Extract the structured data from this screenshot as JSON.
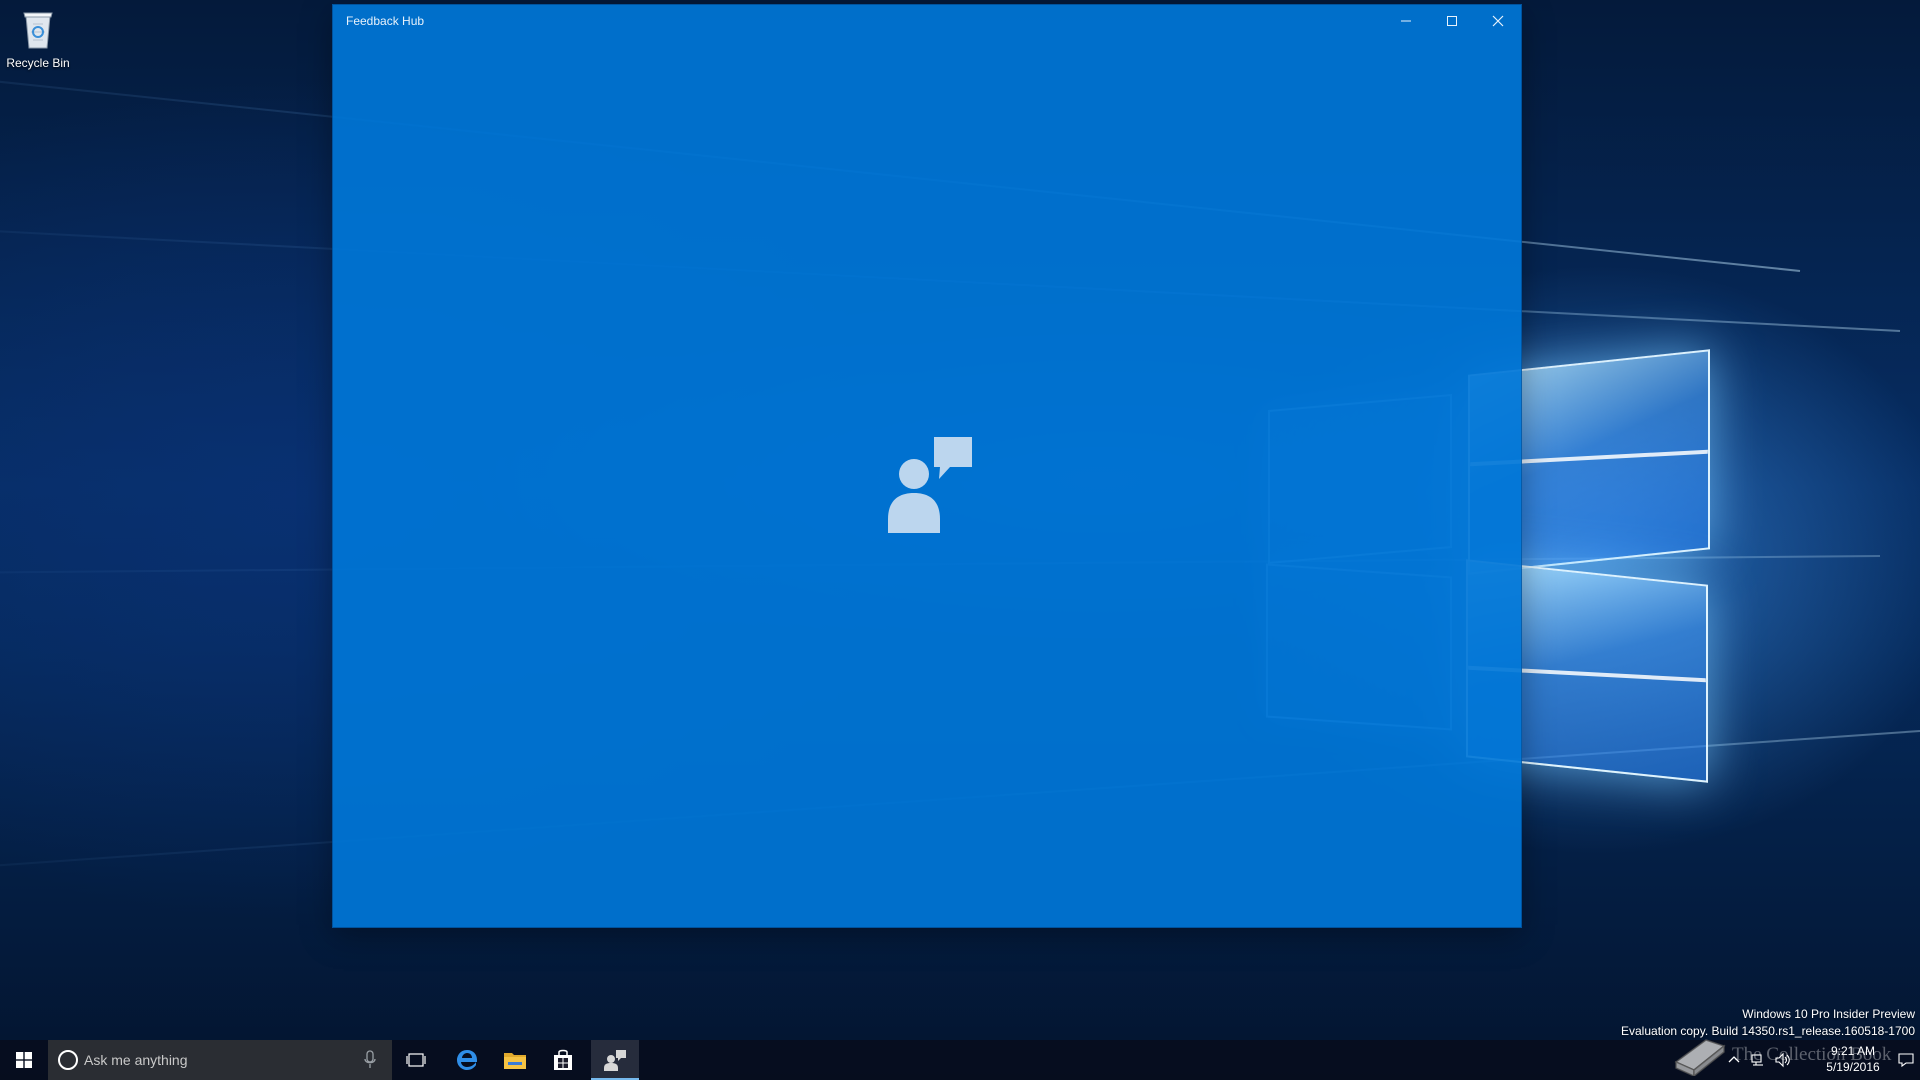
{
  "desktop": {
    "icons": [
      {
        "label": "Recycle Bin",
        "icon": "recycle-bin-icon"
      }
    ]
  },
  "window": {
    "title": "Feedback Hub",
    "controls": {
      "minimize": "minimize-icon",
      "maximize": "maximize-icon",
      "close": "close-icon"
    },
    "splash_icon": "feedback-hub-icon",
    "background_color": "#0078d7"
  },
  "taskbar": {
    "start_icon": "windows-logo-icon",
    "search": {
      "placeholder": "Ask me anything",
      "icon": "cortana-circle-icon",
      "mic_icon": "microphone-icon"
    },
    "pinned": [
      {
        "name": "task-view",
        "icon": "task-view-icon"
      },
      {
        "name": "edge",
        "icon": "edge-icon",
        "color": "#1e88e5"
      },
      {
        "name": "file-explorer",
        "icon": "folder-icon",
        "color": "#f6c343"
      },
      {
        "name": "store",
        "icon": "store-icon"
      },
      {
        "name": "feedback-hub",
        "icon": "feedback-hub-icon",
        "active": true
      }
    ],
    "tray": {
      "icons": [
        "chevron-up-icon",
        "network-icon",
        "volume-icon",
        "action-center-icon"
      ],
      "time": "9:21 AM",
      "date": "5/19/2016"
    }
  },
  "watermark": {
    "line1": "Windows 10 Pro Insider Preview",
    "line2": "Evaluation copy. Build 14350.rs1_release.160518-1700"
  },
  "overlay": {
    "brand": "The Collection Book"
  }
}
